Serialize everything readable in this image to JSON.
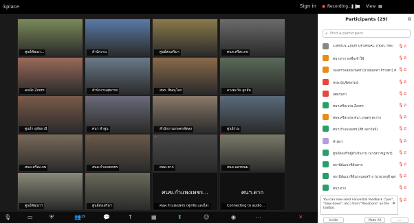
{
  "topbar": {
    "left_text": "kplace",
    "right_text": "Sign in"
  },
  "rec": {
    "recording": "Recording...",
    "view": "View"
  },
  "panel": {
    "title": "Participants (29)",
    "search_placeholder": "Find a participant"
  },
  "tiles": [
    {
      "name": "ศูนย์พัฒนา...",
      "color": "#7a8a5a"
    },
    {
      "name": "สำนักงาน",
      "color": "#5a7aa8"
    },
    {
      "name": "ศูนย์ส่งเสริมฯ",
      "color": "#8a7a4a"
    },
    {
      "name": "ศนค.ศรีสะเกษ",
      "color": "#6b6b6b"
    },
    {
      "name": "คนนิ่ง Zoom",
      "color": "#9a6a5a"
    },
    {
      "name": "สำนักงานสุขภาพ",
      "color": "#6a7a8a"
    },
    {
      "name": "สนร. พิษณุโลก",
      "color": "#8a6a4a"
    },
    {
      "name": "ดวงตะวัน ลูกลั่น",
      "color": "#5a6a5a"
    },
    {
      "name": "ศูนย์ฯ อุทัยธานี",
      "color": "#7a5a4a"
    },
    {
      "name": "ศนฯ ลำพูน",
      "color": "#6a6a7a"
    },
    {
      "name": "สำนักงานเกษตรพัทลุง",
      "color": "#8a7a6a"
    },
    {
      "name": "ศูนย์ร่วม",
      "color": "#5a6a7a"
    },
    {
      "name": "ศนค.ศรีสะเกษ",
      "color": "#7a6a5a"
    },
    {
      "name": "สนค.กำแพงเพชร",
      "color": "#6a5a4a"
    },
    {
      "name": "ศนค.ตาก",
      "color": "#4a4a4a"
    },
    {
      "name": "สนค.นครพนม",
      "color": "#7a7a6a"
    },
    {
      "name": "ศูนย์พัฒนาฯ",
      "color": "#8a8a7a"
    },
    {
      "name": "ศูนย์ส่งเสริมฯ",
      "color": "#6a6a5a"
    },
    {
      "name": "ศนฯ ตาก",
      "color": "#5a5a5a"
    },
    {
      "name": "ศนฯ.กำแพงเพชร",
      "color": "#555555"
    }
  ],
  "big_tiles": [
    {
      "text": "ศนข.กำแพงเพชร...",
      "name": "ศนค.กำแพงเพชร (ศุภชัย แสงใส)"
    },
    {
      "text": "ศนฯ.ตาก",
      "name": "Connecting to audio..."
    }
  ],
  "participants": [
    {
      "name": "Client01 Zoom OPSMOAC (Host, me)",
      "color": "#888888"
    },
    {
      "name": "ศนฯ.ตาก ลงชื่อเข้าใช้",
      "color": "#e88c1a"
    },
    {
      "name": "กองตรวจสอบเกษตร (นายมณฑา จิรวงศา) ตัวแทนสำนักงาน",
      "color": "#e88c1a"
    },
    {
      "name": "สกษ.บัญชีสหกรณ์",
      "color": "#e8453c"
    },
    {
      "name": "ยศธรสภา",
      "color": "#e8453c"
    },
    {
      "name": "ศนฯ.ศรีสะเกษ Zoom",
      "color": "#2a9d6a"
    },
    {
      "name": "ศพพ.ศรีสะเกษ ศนฯ.เกษตร ตะราง",
      "color": "#e88c1a"
    },
    {
      "name": "ศนฯ.กำแพงเพชร (ศิริ ลดาวัลย์)",
      "color": "#2a9d6a"
    },
    {
      "name": "สำนักฯ",
      "color": "#b39ddb"
    },
    {
      "name": "ศูนย์ส่งเสริมผู้ดำเนินงาน (นางสาวชฎาพร)",
      "color": "#2a9d6a"
    },
    {
      "name": "สถานีพัฒนาที่ดินตาก",
      "color": "#2a9d6a"
    },
    {
      "name": "สถานีพัฒนาที่ดินระนองสร้าง (นายวลฤดี อุดร)",
      "color": "#2a9d6a"
    },
    {
      "name": "ศนฯ.ตาก",
      "color": "#2a9d6a"
    },
    {
      "name": "สำนักงานคณะกรรมการอนุ",
      "color": "#2a9d6a"
    }
  ],
  "toast": {
    "text": "You can now send nonverbal feedback (\"yes\", \"slow down\", etc.) from \"Reactions\" on the toolbar."
  },
  "footer": {
    "invite": "Invite",
    "mute_all": "Mute All",
    "more": "..."
  },
  "toolbar": {
    "mute": "",
    "participants_count": "29",
    "chat": "Chat",
    "share": "Share Screen",
    "record": "Record",
    "reactions": "Reactions",
    "end": "End"
  }
}
